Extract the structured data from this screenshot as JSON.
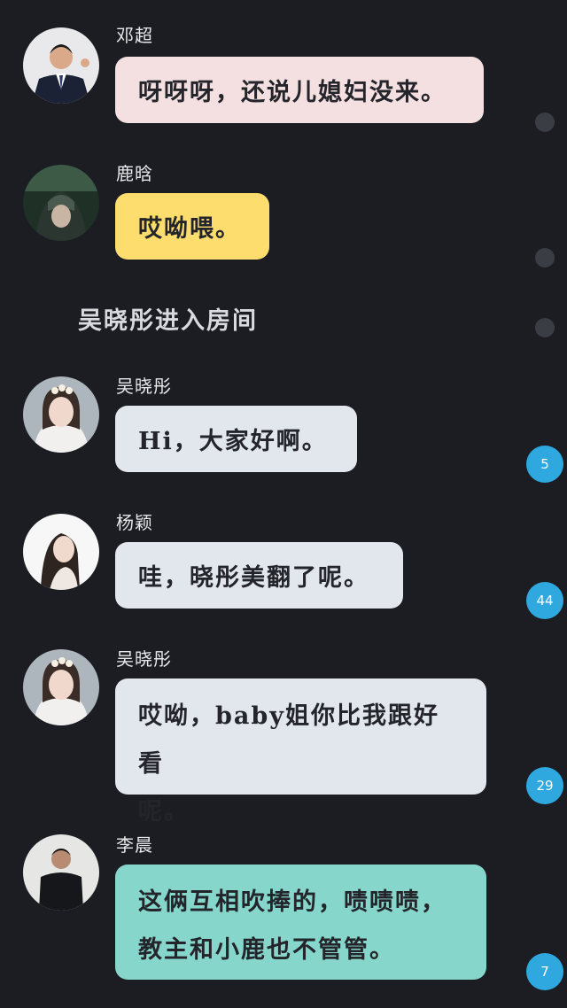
{
  "messages": [
    {
      "name": "邓超",
      "text": "呀呀呀，还说儿媳妇没来。",
      "bubble_color": "#f4dfe1"
    },
    {
      "name": "鹿晗",
      "text": "哎呦喂。",
      "bubble_color": "#fddd6d"
    },
    {
      "name": "吴晓彤",
      "text": "Hi，大家好啊。",
      "bubble_color": "#e2e6ed"
    },
    {
      "name": "杨颖",
      "text": "哇，晓彤美翻了呢。",
      "bubble_color": "#e2e6ed"
    },
    {
      "name": "吴晓彤",
      "text_line1": "哎呦，baby姐你比我跟好看",
      "text_line2": "呢。",
      "bubble_color": "#e2e6ed"
    },
    {
      "name": "李晨",
      "text_line1": "这俩互相吹捧的，啧啧啧，",
      "text_line2": "教主和小鹿也不管管。",
      "bubble_color": "#86d6cb"
    }
  ],
  "system_notice": "吴晓彤进入房间",
  "badges": [
    "5",
    "44",
    "29",
    "7"
  ],
  "avatar_icons": [
    "avatar-dengchao-icon",
    "avatar-luhan-icon",
    "avatar-wuxiaotong-icon",
    "avatar-yangying-icon",
    "avatar-wuxiaotong-icon",
    "avatar-lichen-icon"
  ],
  "colors": {
    "background": "#1b1d22",
    "badge": "#2fa8df",
    "dot": "#3a3d44"
  }
}
